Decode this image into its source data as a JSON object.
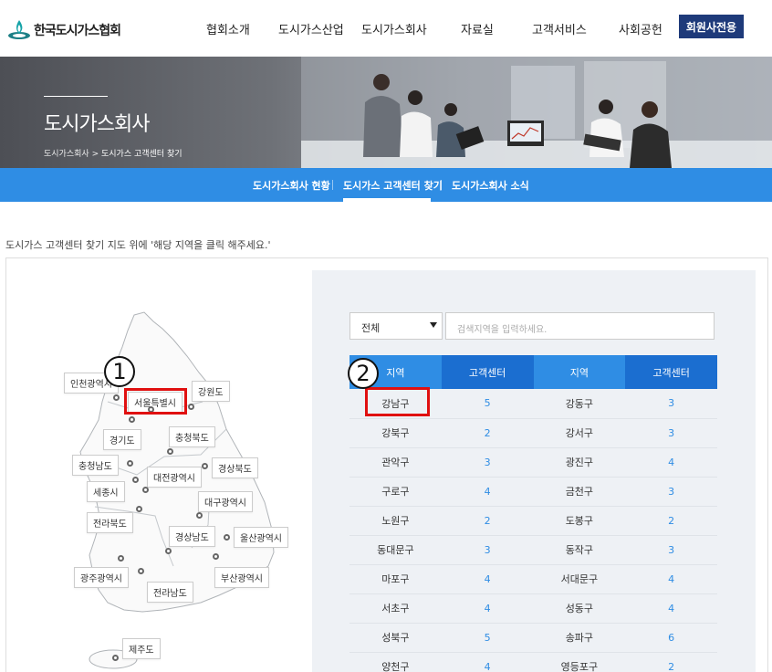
{
  "header": {
    "logo_text": "한국도시가스협회",
    "nav": [
      "협회소개",
      "도시가스산업",
      "도시가스회사",
      "자료실",
      "고객서비스",
      "사회공헌"
    ],
    "member_button": "회원사전용"
  },
  "hero": {
    "title": "도시가스회사",
    "breadcrumb_parent": "도시가스회사",
    "breadcrumb_sep": ">",
    "breadcrumb_current": "도시가스 고객센터 찾기"
  },
  "subnav": [
    "도시가스회사 현황",
    "도시가스 고객센터 찾기",
    "도시가스회사 소식"
  ],
  "instruction": "도시가스 고객센터 찾기 지도 위에 '해당 지역을 클릭 해주세요.'",
  "map": {
    "regions": [
      "인천광역시",
      "서울특별시",
      "강원도",
      "경기도",
      "충청북도",
      "충청남도",
      "대전광역시",
      "경상북도",
      "세종시",
      "대구광역시",
      "전라북도",
      "경상남도",
      "울산광역시",
      "광주광역시",
      "부산광역시",
      "전라남도",
      "제주도"
    ]
  },
  "annotations": {
    "num1": "1",
    "num2": "2"
  },
  "filter": {
    "select_value": "전체",
    "search_placeholder": "검색지역을 입력하세요."
  },
  "table": {
    "headers": [
      "지역",
      "고객센터",
      "지역",
      "고객센터"
    ],
    "rows": [
      [
        "강남구",
        "5",
        "강동구",
        "3"
      ],
      [
        "강북구",
        "2",
        "강서구",
        "3"
      ],
      [
        "관악구",
        "3",
        "광진구",
        "4"
      ],
      [
        "구로구",
        "4",
        "금천구",
        "3"
      ],
      [
        "노원구",
        "2",
        "도봉구",
        "2"
      ],
      [
        "동대문구",
        "3",
        "동작구",
        "3"
      ],
      [
        "마포구",
        "4",
        "서대문구",
        "4"
      ],
      [
        "서초구",
        "4",
        "성동구",
        "4"
      ],
      [
        "성북구",
        "5",
        "송파구",
        "6"
      ],
      [
        "양천구",
        "4",
        "영등포구",
        "2"
      ]
    ]
  },
  "colors": {
    "accent": "#2f8de4",
    "dark_accent": "#1b6ed0",
    "highlight": "#e01010",
    "member_btn": "#1e3a7a"
  }
}
